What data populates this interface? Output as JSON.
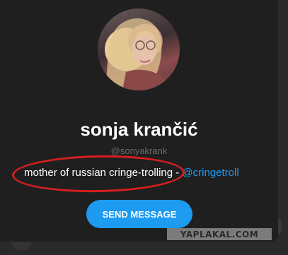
{
  "profile": {
    "name": "sonja krančić",
    "handle": "@sonyakrank",
    "bio_text": "mother of russian cringe-trolling - ",
    "bio_link": "@cringetroll"
  },
  "actions": {
    "send_message_label": "SEND MESSAGE"
  },
  "watermark": {
    "text": "YAPLAKAL.COM"
  },
  "colors": {
    "card_background": "#1f1f20",
    "accent": "#1d9bf0",
    "highlight_oval": "#d81e1e",
    "muted_text": "#6b6b6b"
  },
  "icons": {
    "avatar": "profile-photo"
  }
}
